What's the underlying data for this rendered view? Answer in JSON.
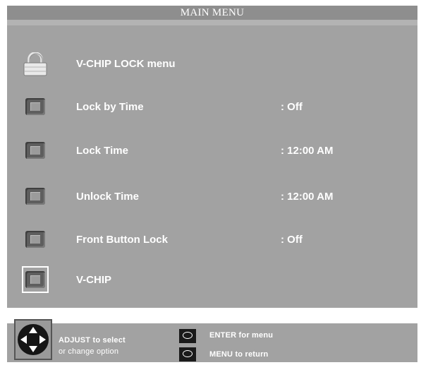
{
  "header": {
    "title": "MAIN MENU"
  },
  "menu": {
    "header_item": {
      "label": "V-CHIP LOCK menu",
      "icon": "padlock-icon"
    },
    "items": [
      {
        "label": "Lock by Time",
        "value": ": Off",
        "icon": "square-button-icon"
      },
      {
        "label": "Lock Time",
        "value": ": 12:00 AM",
        "icon": "square-button-icon"
      },
      {
        "label": "Unlock Time",
        "value": ": 12:00 AM",
        "icon": "square-button-icon"
      },
      {
        "label": "Front Button Lock",
        "value": ": Off",
        "icon": "square-button-icon"
      },
      {
        "label": "V-CHIP",
        "value": "",
        "icon": "square-button-icon",
        "selected": true
      }
    ]
  },
  "help": {
    "adjust_line1": "ADJUST to select",
    "adjust_line2": "or  change option",
    "enter_label": "ENTER for menu",
    "menu_label": "MENU to return",
    "dpad_icon": "dpad-arrows-icon",
    "enter_icon": "oval-button-icon",
    "menu_icon": "oval-button-icon"
  },
  "colors": {
    "panel": "#a2a2a2",
    "title_bar": "#8e8e8e",
    "text": "#ffffff",
    "selection_frame": "#ffffff"
  }
}
